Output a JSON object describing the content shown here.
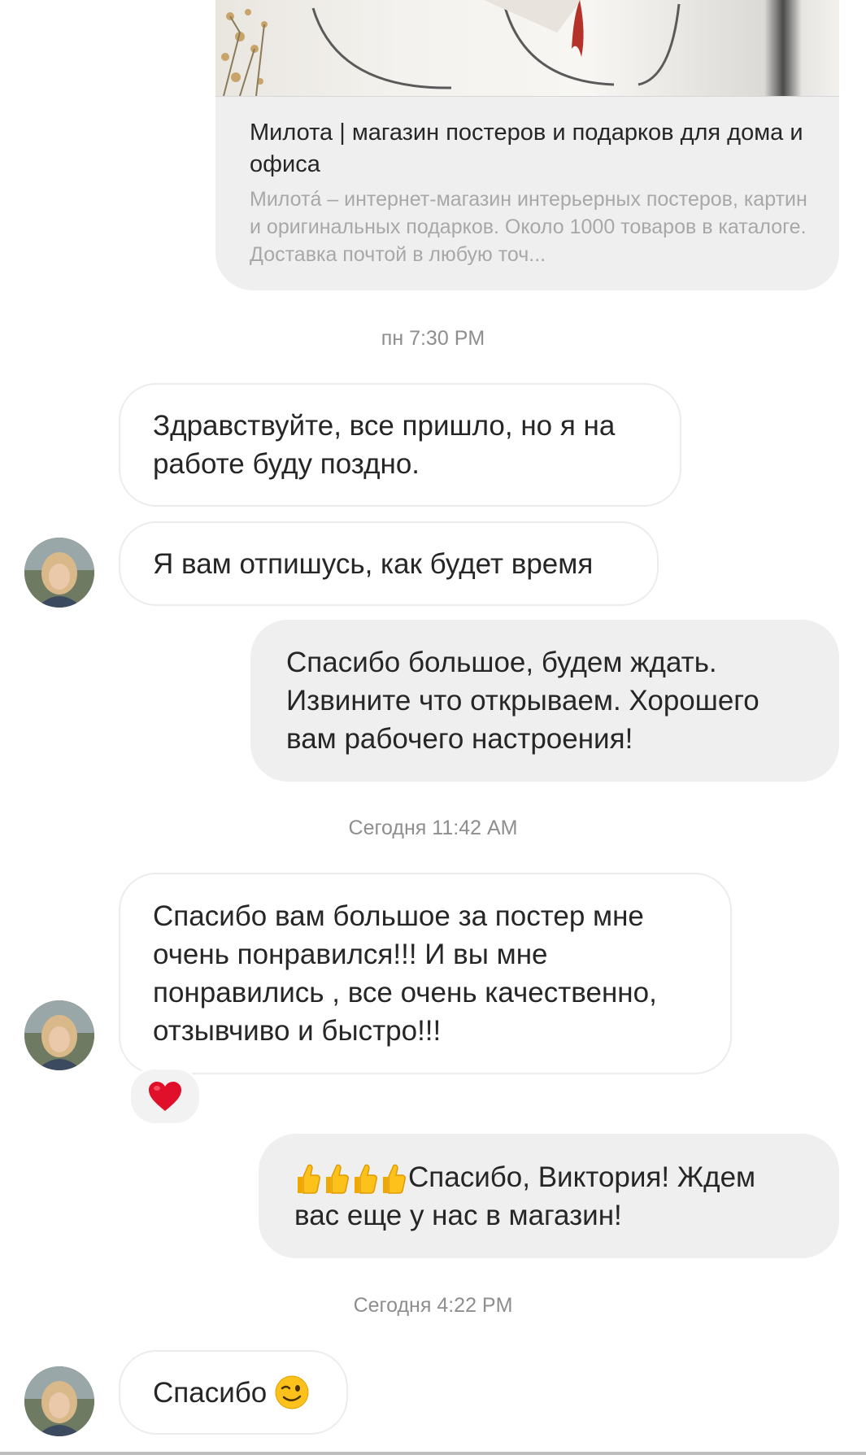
{
  "link_preview": {
    "title": "Милота | магазин постеров и подарков для дома и офиса",
    "description": "Милотá – интернет-магазин интерьерных постеров, картин и оригинальных подарков. Около 1000 товаров в каталоге. Доставка почтой в любую точ..."
  },
  "timestamps": {
    "t1": "пн 7:30 PM",
    "t2": "Сегодня 11:42 AM",
    "t3": "Сегодня 4:22 PM"
  },
  "messages": [
    {
      "direction": "incoming",
      "text": "Здравствуйте, все пришло, но я на работе буду поздно."
    },
    {
      "direction": "incoming",
      "text": "Я вам отпишусь, как будет время"
    },
    {
      "direction": "outgoing",
      "text": "Спасибо большое, будем ждать. Извините что открываем. Хорошего вам рабочего настроения!"
    },
    {
      "direction": "incoming",
      "text": "Спасибо вам большое за постер мне очень понравился!!! И вы мне понравились , все очень качественно, отзывчиво и быстро!!!"
    },
    {
      "direction": "outgoing",
      "text_line1": "Спасибо, Виктория! Ждем",
      "text_line2": "вас еще у нас в магазин!",
      "emoji": "thumbs-up x4"
    },
    {
      "direction": "incoming",
      "text": "Спасибо",
      "emoji": "winking-face"
    }
  ],
  "reaction": {
    "emoji": "red-heart",
    "color": "#e0102b"
  },
  "colors": {
    "incoming_bg": "#ffffff",
    "outgoing_bg": "#efefef",
    "incoming_border": "#ececec",
    "timestamp": "#8e8e8e"
  }
}
